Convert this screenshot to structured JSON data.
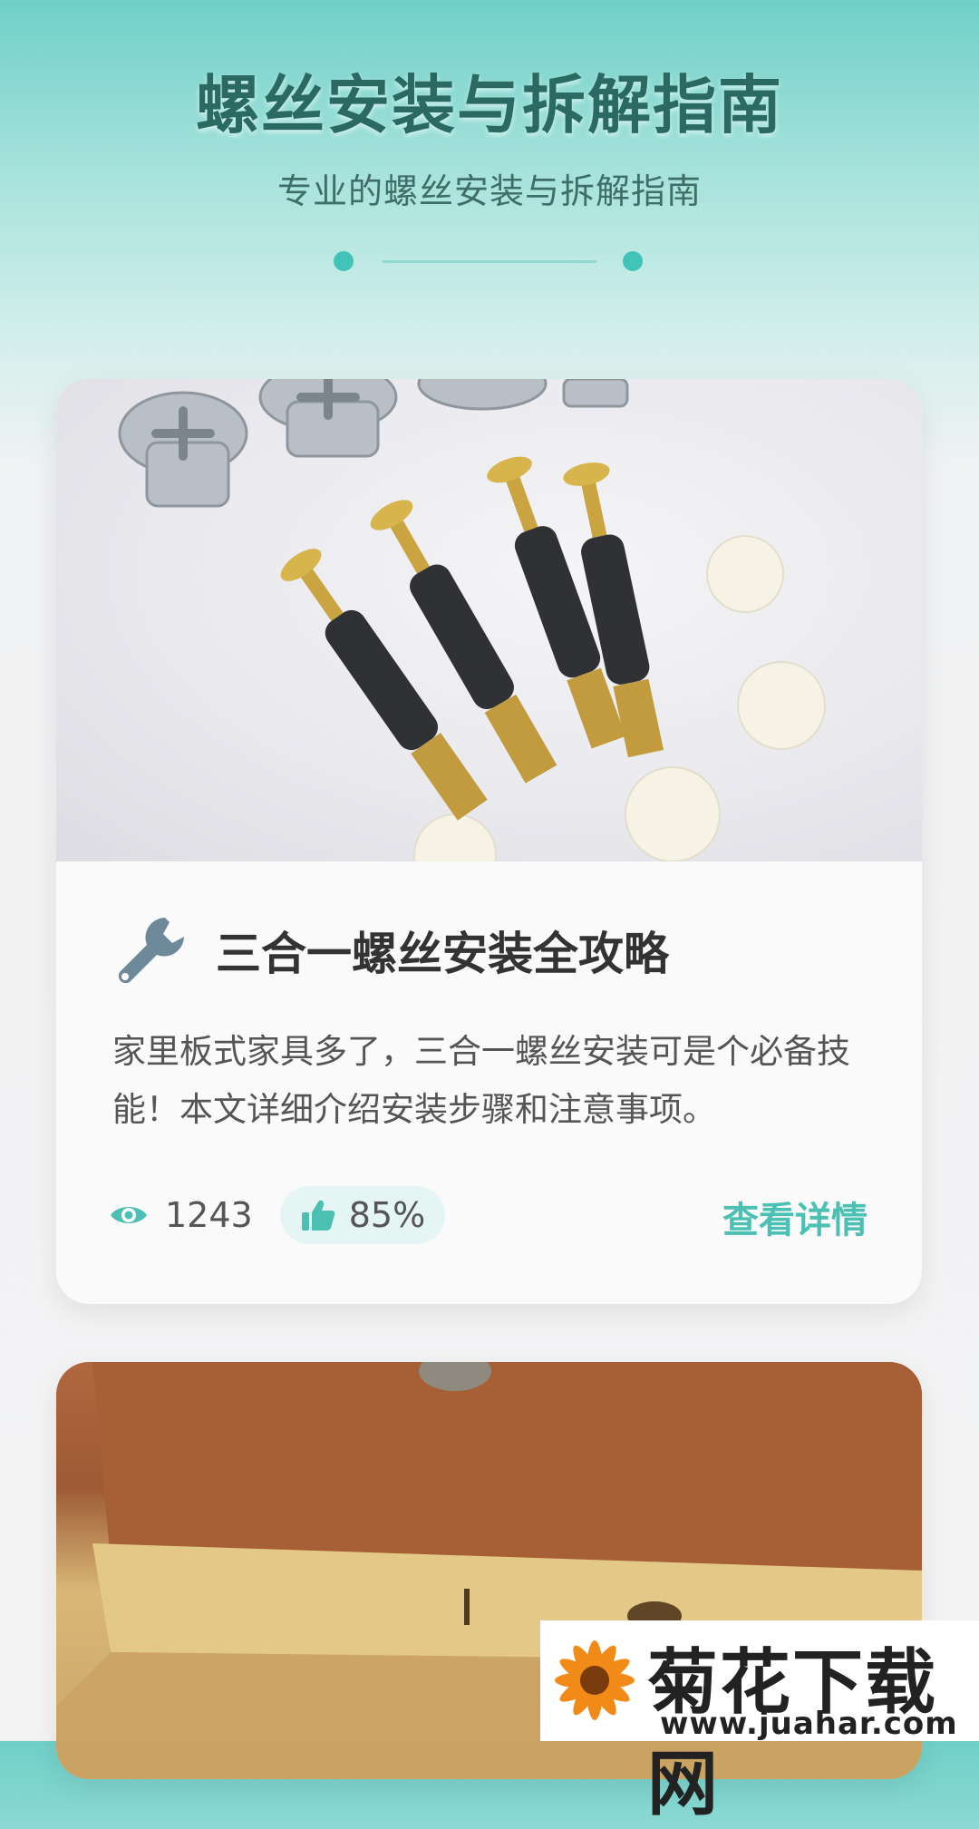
{
  "header": {
    "title": "螺丝安装与拆解指南",
    "subtitle": "专业的螺丝安装与拆解指南"
  },
  "cards": [
    {
      "image": "three-in-one-connector-screws-photo",
      "icon": "wrench-icon",
      "title": "三合一螺丝安装全攻略",
      "description": "家里板式家具多了，三合一螺丝安装可是个必备技能！本文详细介绍安装步骤和注意事项。",
      "views": "1243",
      "like_rate": "85%",
      "action": "查看详情"
    },
    {
      "image": "particle-board-with-screw-hole-photo"
    }
  ],
  "watermark": {
    "name": "菊花下载网",
    "url": "www.juahar.com"
  },
  "colors": {
    "accent": "#4bc0b3",
    "title": "#2b6a62",
    "header_gradient_top": "#6fd0c8"
  }
}
